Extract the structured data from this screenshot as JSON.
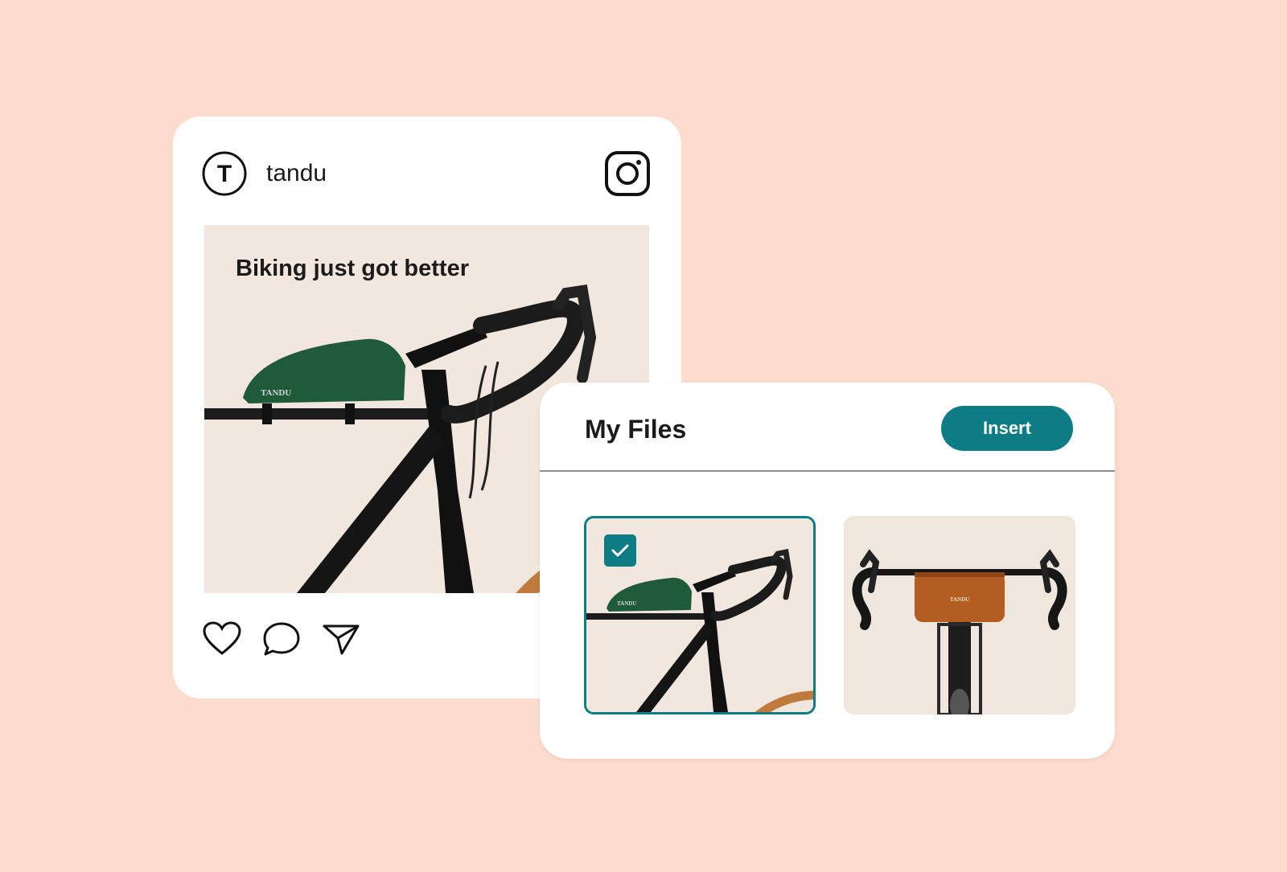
{
  "post": {
    "avatar_letter": "T",
    "username": "tandu",
    "caption": "Biking just got better",
    "bag_brand": "TANDU",
    "icons": [
      "instagram-icon",
      "heart-icon",
      "comment-icon",
      "share-icon"
    ]
  },
  "files": {
    "title": "My Files",
    "insert_label": "Insert",
    "thumbnails": [
      {
        "brand": "TANDU",
        "selected": true
      },
      {
        "brand": "TANDU",
        "selected": false
      }
    ]
  },
  "colors": {
    "background": "#fddbcd",
    "accent": "#0d7c84",
    "bag_green": "#1f5a3a",
    "bag_orange": "#b35d22"
  }
}
